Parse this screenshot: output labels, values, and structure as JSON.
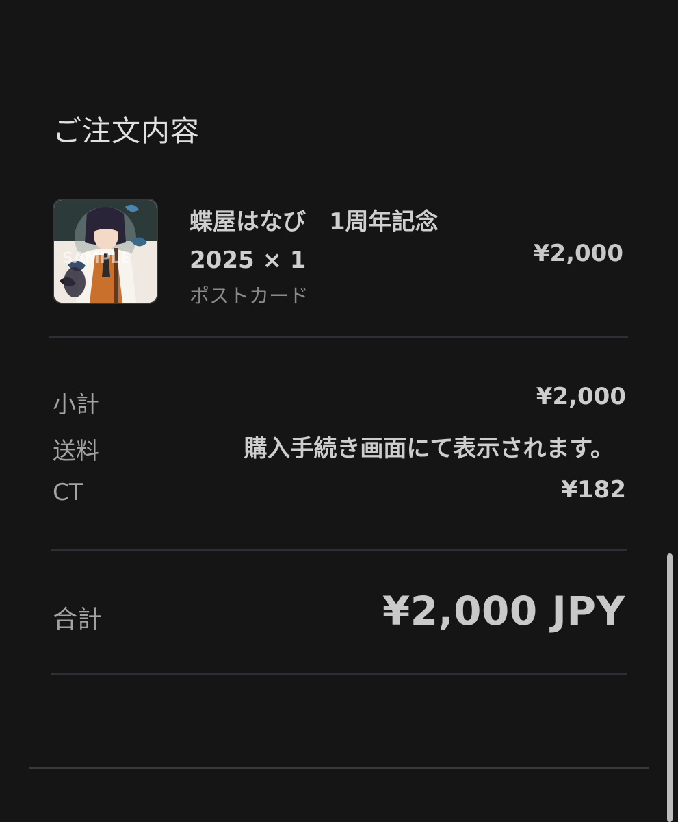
{
  "section_title": "ご注文内容",
  "item": {
    "name_line1": "蝶屋はなび　1周年記念",
    "name_line2": "2025 × 1",
    "variant": "ポストカード",
    "price": "¥2,000",
    "thumbnail_icon": "product-thumbnail"
  },
  "summary": {
    "subtotal_label": "小計",
    "subtotal_value": "¥2,000",
    "shipping_label": "送料",
    "shipping_value": "購入手続き画面にて表示されます。",
    "ct_label": "CT",
    "ct_value": "¥182"
  },
  "total": {
    "label": "合計",
    "value": "¥2,000 JPY"
  },
  "colors": {
    "background": "#151515",
    "divider": "#2e2e34",
    "text_primary": "#cfcfcf",
    "text_secondary": "#8a8a8a"
  }
}
